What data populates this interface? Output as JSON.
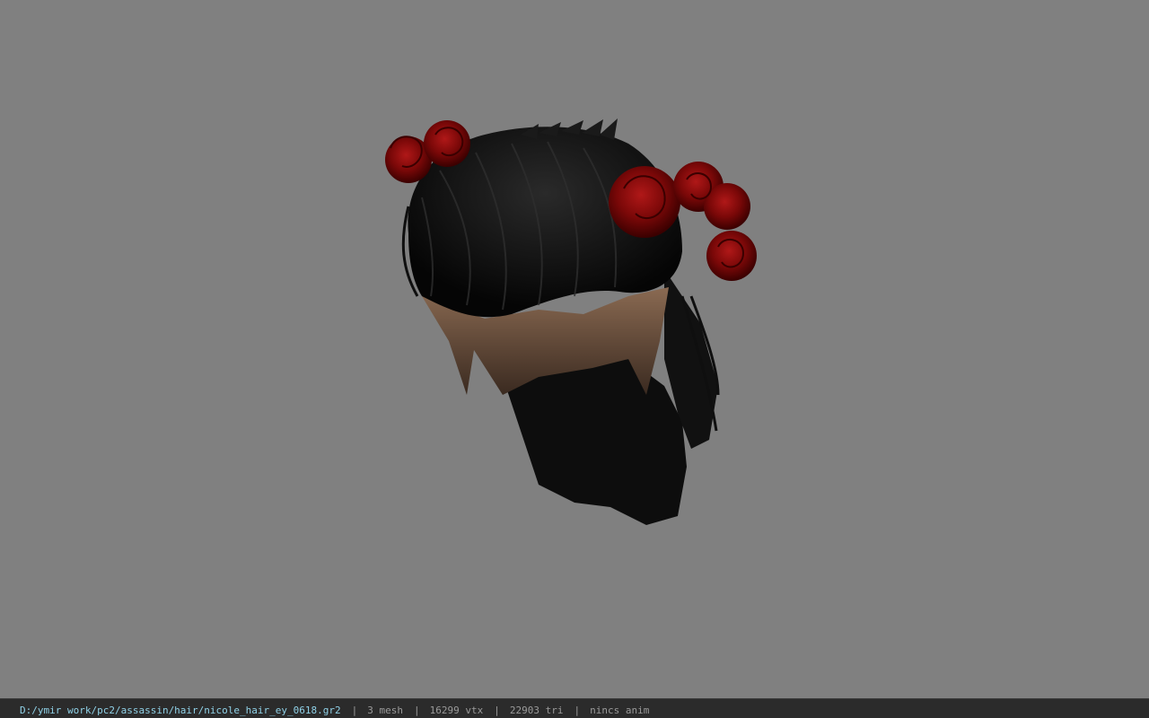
{
  "viewer": {
    "background_color": "#808080",
    "model_icon": "hair-model-icon"
  },
  "statusbar": {
    "file_path": "D:/ymir work/pc2/assassin/hair/nicole_hair_ey_0618.gr2",
    "separator": "|",
    "mesh_count": "3 mesh",
    "vertex_count": "16299 vtx",
    "triangle_count": "22903 tri",
    "animation": "nincs anim",
    "path_color": "#8fd0e6",
    "info_color": "#9a9a9a"
  }
}
